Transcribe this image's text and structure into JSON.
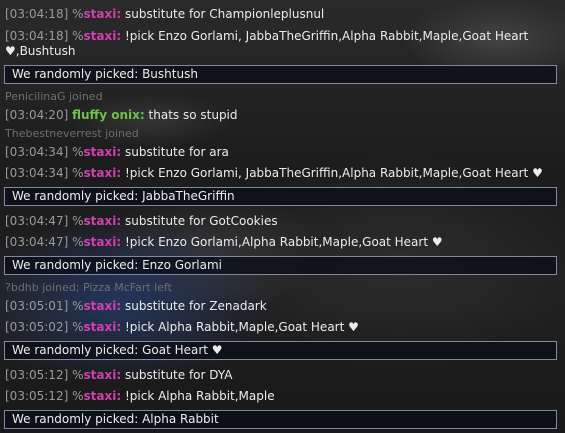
{
  "lines": [
    {
      "ts": "[03:04:18]",
      "prefix": "%",
      "nick": "staxi:",
      "text": "substitute for Championleplusnul"
    },
    {
      "ts": "[03:04:18]",
      "prefix": "%",
      "nick": "staxi:",
      "text": "!pick Enzo Gorlami, JabbaTheGriffin,Alpha Rabbit,Maple,Goat Heart",
      "text2": "♥,Bushtush"
    },
    {
      "pick": "We randomly picked:  Bushtush"
    },
    {
      "sys": "PenicilinaG joined"
    },
    {
      "ts": "[03:04:20]",
      "nick": "fluffy onix:",
      "text": "thats so stupid"
    },
    {
      "sys": "Thebestneverrest joined"
    },
    {
      "ts": "[03:04:34]",
      "prefix": "%",
      "nick": "staxi:",
      "text": "substitute for ara"
    },
    {
      "ts": "[03:04:34]",
      "prefix": "%",
      "nick": "staxi:",
      "text": "!pick Enzo Gorlami, JabbaTheGriffin,Alpha Rabbit,Maple,Goat Heart ♥"
    },
    {
      "pick": "We randomly picked:  JabbaTheGriffin"
    },
    {
      "ts": "[03:04:47]",
      "prefix": "%",
      "nick": "staxi:",
      "text": "substitute for GotCookies"
    },
    {
      "ts": "[03:04:47]",
      "prefix": "%",
      "nick": "staxi:",
      "text": "!pick Enzo Gorlami,Alpha Rabbit,Maple,Goat Heart ♥"
    },
    {
      "pick": "We randomly picked:  Enzo Gorlami"
    },
    {
      "sys": "?bdhb joined; Pizza McFart left"
    },
    {
      "ts": "[03:05:01]",
      "prefix": "%",
      "nick": "staxi:",
      "text": "substitute for Zenadark"
    },
    {
      "ts": "[03:05:02]",
      "prefix": "%",
      "nick": "staxi:",
      "text": "!pick Alpha Rabbit,Maple,Goat Heart ♥"
    },
    {
      "pick": "We randomly picked:  Goat Heart ♥"
    },
    {
      "ts": "[03:05:12]",
      "prefix": "%",
      "nick": "staxi:",
      "text": "substitute for DYA"
    },
    {
      "ts": "[03:05:12]",
      "prefix": "%",
      "nick": "staxi:",
      "text": "!pick Alpha Rabbit,Maple"
    },
    {
      "pick": "We randomly picked:  Alpha Rabbit"
    }
  ],
  "colors": {
    "nick_staxi": "#d23fb1",
    "nick_fluffy": "#6cc24a",
    "timestamp": "#9a9a9a",
    "system": "#6f6f6f",
    "pick_border": "#7f8aa0"
  }
}
